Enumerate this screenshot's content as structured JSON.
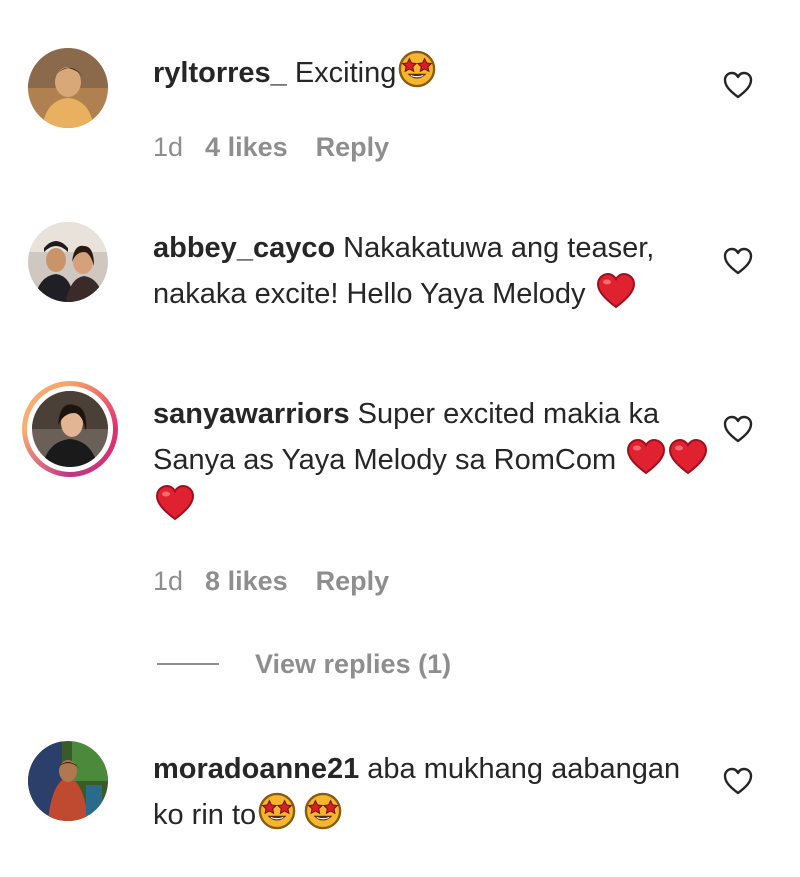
{
  "comments": [
    {
      "username": "ryltorres_",
      "text": "Exciting",
      "time": "1d",
      "likes": "4 likes",
      "reply": "Reply",
      "emojis": [
        "star-struck-emoji"
      ]
    },
    {
      "username": "abbey_cayco",
      "text": "Nakakatuwa ang teaser, nakaka excite! Hello Yaya Melody",
      "emojis": [
        "red-heart-emoji"
      ]
    },
    {
      "username": "sanyawarriors",
      "text": "Super excited makia ka Sanya as Yaya Melody sa RomCom",
      "time": "1d",
      "likes": "8 likes",
      "reply": "Reply",
      "emojis": [
        "red-heart-emoji",
        "red-heart-emoji",
        "red-heart-emoji"
      ]
    },
    {
      "username": "moradoanne21",
      "text": "aba mukhang aabangan ko rin to",
      "emojis": [
        "star-struck-emoji",
        "star-struck-emoji"
      ]
    }
  ],
  "view_replies": "View replies (1)",
  "icons": {
    "like": "heart-outline-icon"
  },
  "colors": {
    "text": "#262626",
    "secondary": "#8e8e8e",
    "heart_red": "#e0212f",
    "emoji_yellow": "#f5b52c"
  }
}
